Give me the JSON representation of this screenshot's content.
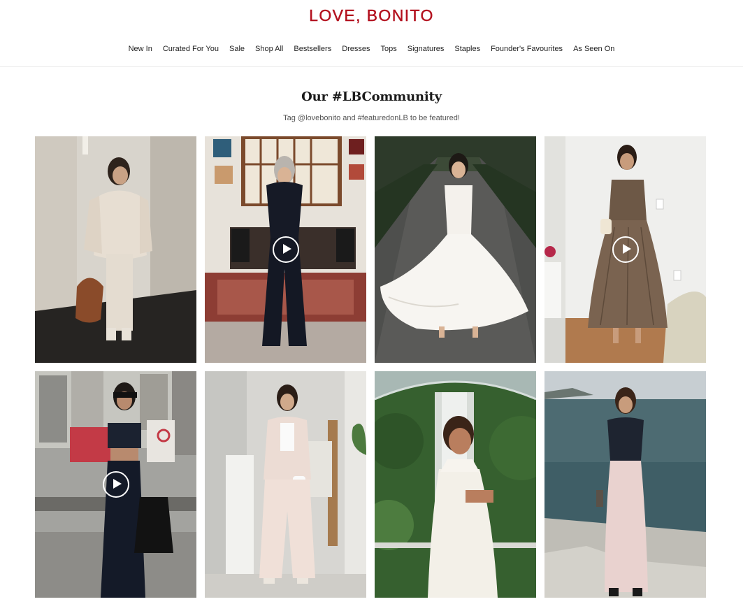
{
  "brand": {
    "logo_text": "LOVE, BONITO",
    "accent_color": "#b3111e"
  },
  "nav": {
    "items": [
      "New In",
      "Curated For You",
      "Sale",
      "Shop All",
      "Bestsellers",
      "Dresses",
      "Tops",
      "Signatures",
      "Staples",
      "Founder's Favourites",
      "As Seen On"
    ]
  },
  "community": {
    "title": "Our #LBCommunity",
    "subtitle": "Tag @lovebonito and #featuredonLB to be featured!"
  },
  "gallery": {
    "tiles": [
      {
        "icon": "photo-icon",
        "is_video": false
      },
      {
        "icon": "play-icon",
        "is_video": true
      },
      {
        "icon": "photo-icon",
        "is_video": false
      },
      {
        "icon": "play-icon",
        "is_video": true
      },
      {
        "icon": "play-icon",
        "is_video": true
      },
      {
        "icon": "photo-icon",
        "is_video": false
      },
      {
        "icon": "photo-icon",
        "is_video": false
      },
      {
        "icon": "photo-icon",
        "is_video": false
      }
    ]
  }
}
